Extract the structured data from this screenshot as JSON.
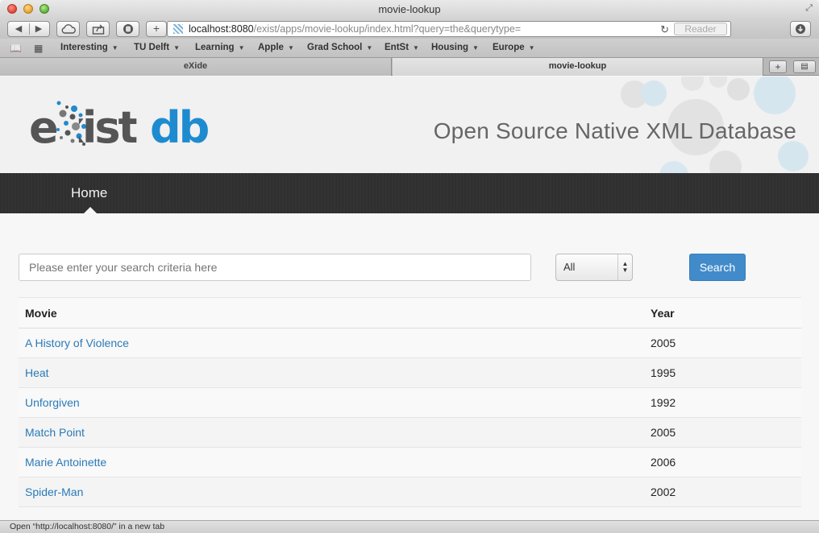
{
  "window": {
    "title": "movie-lookup"
  },
  "toolbar": {
    "url_host": "localhost:8080",
    "url_path": "/exist/apps/movie-lookup/index.html?query=the&querytype=",
    "reader_label": "Reader"
  },
  "bookmarks": [
    {
      "label": "Interesting"
    },
    {
      "label": "TU Delft"
    },
    {
      "label": "Learning"
    },
    {
      "label": "Apple"
    },
    {
      "label": "Grad School"
    },
    {
      "label": "EntSt"
    },
    {
      "label": "Housing"
    },
    {
      "label": "Europe"
    }
  ],
  "tabs": [
    {
      "label": "eXide"
    },
    {
      "label": "movie-lookup"
    }
  ],
  "header": {
    "logo_part1": "e",
    "logo_part2": "xist",
    "logo_part3": "db",
    "tagline": "Open Source Native XML Database"
  },
  "nav": {
    "home": "Home"
  },
  "search": {
    "placeholder": "Please enter your search criteria here",
    "type_selected": "All",
    "button": "Search"
  },
  "table": {
    "headers": [
      "Movie",
      "Year"
    ],
    "rows": [
      {
        "movie": "A History of Violence",
        "year": "2005"
      },
      {
        "movie": "Heat",
        "year": "1995"
      },
      {
        "movie": "Unforgiven",
        "year": "1992"
      },
      {
        "movie": "Match Point",
        "year": "2005"
      },
      {
        "movie": "Marie Antoinette",
        "year": "2006"
      },
      {
        "movie": "Spider-Man",
        "year": "2002"
      }
    ]
  },
  "status": {
    "text": "Open “http://localhost:8080/” in a new tab"
  },
  "colors": {
    "link": "#2a7ab8",
    "primary_button": "#428bca",
    "logo_dark": "#555555",
    "logo_blue": "#1e8bd0",
    "navbar": "#333333"
  }
}
